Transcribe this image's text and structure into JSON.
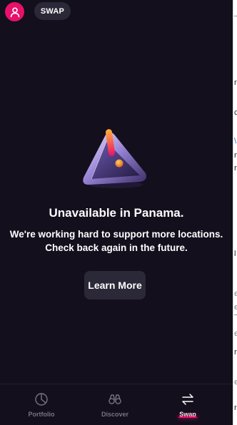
{
  "header": {
    "swap_pill_label": "SWAP"
  },
  "main": {
    "title": "Unavailable in Panama.",
    "subtitle_line1": "We're working hard to support more locations.",
    "subtitle_line2": "Check back again in the future.",
    "learn_more_label": "Learn More"
  },
  "nav": {
    "items": [
      {
        "label": "Portfolio",
        "icon": "portfolio-pie-icon",
        "active": false
      },
      {
        "label": "Discover",
        "icon": "binoculars-icon",
        "active": false
      },
      {
        "label": "Swap",
        "icon": "swap-arrows-icon",
        "active": true
      }
    ]
  },
  "right_strip_fragments": [
    "r",
    "c",
    "\\",
    "n",
    "r",
    "l",
    "e",
    "e",
    "e",
    "r",
    "e",
    "r"
  ],
  "colors": {
    "background": "#130f1c",
    "accent": "#e8106a",
    "surface": "#2b2838",
    "nav_inactive": "#77737f"
  }
}
